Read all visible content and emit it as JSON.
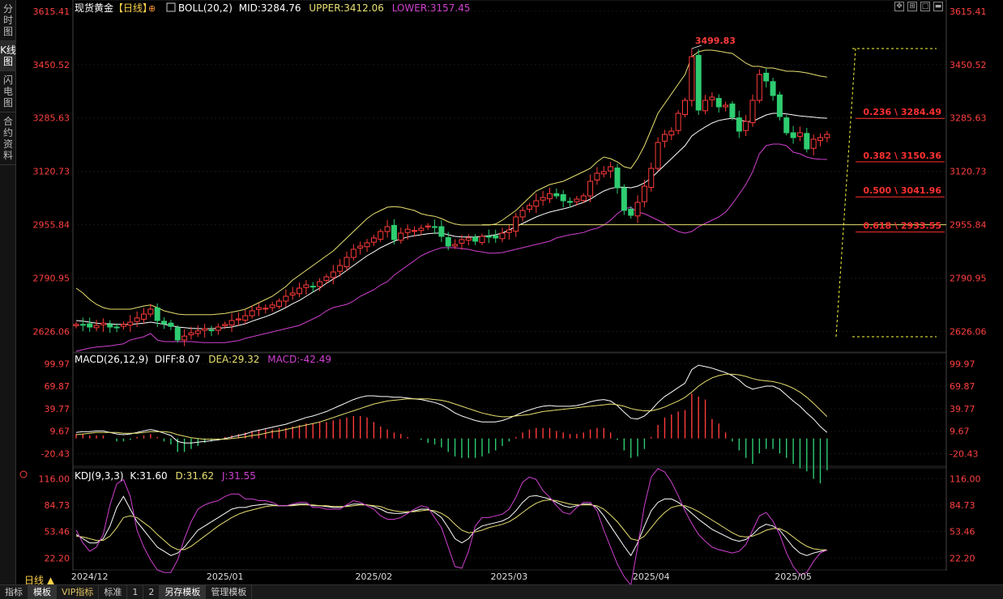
{
  "sidebar": {
    "tabs": [
      {
        "label": "分时图",
        "active": false
      },
      {
        "label": "K线图",
        "active": true
      },
      {
        "label": "闪电图",
        "active": false
      },
      {
        "label": "合约资料",
        "active": false
      }
    ]
  },
  "header": {
    "instrument": "现货黄金",
    "period_tag": "【日线】",
    "boll_label": "BOLL(20,2)",
    "mid": "MID:3284.76",
    "upper": "UPPER:3412.06",
    "lower": "LOWER:3157.45"
  },
  "macd_header": {
    "label": "MACD(26,12,9)",
    "diff": "DIFF:8.07",
    "dea": "DEA:29.32",
    "macd": "MACD:-42.49"
  },
  "kdj_header": {
    "label": "KDJ(9,3,3)",
    "k": "K:31.60",
    "d": "D:31.62",
    "j": "J:31.55"
  },
  "period_selector": "日线 ▲",
  "footer": {
    "items": [
      {
        "label": "指标",
        "active": false,
        "vip": false
      },
      {
        "label": "模板",
        "active": true,
        "vip": false
      },
      {
        "label": "VIP指标",
        "active": false,
        "vip": true
      },
      {
        "label": "标准",
        "active": false,
        "vip": false
      },
      {
        "label": "1",
        "active": false,
        "vip": false
      },
      {
        "label": "2",
        "active": false,
        "vip": false
      },
      {
        "label": "另存模板",
        "active": true,
        "vip": false
      },
      {
        "label": "管理模板",
        "active": false,
        "vip": false
      }
    ]
  },
  "colors": {
    "up": "#ff3b3b",
    "down": "#2ecc71",
    "upper": "#e8e070",
    "mid": "#ffffff",
    "lower": "#d040d0",
    "axis_text": "#ff4040",
    "grid": "#1a1a1a",
    "fib": "#ff3030"
  },
  "chart_data": [
    {
      "type": "candlestick",
      "title": "现货黄金【日线】",
      "ylim": [
        2570,
        3640
      ],
      "y_ticks": [
        3615.41,
        3450.52,
        3285.63,
        3120.73,
        2955.84,
        2790.95,
        2626.06
      ],
      "y_tick_labels": [
        "3615.41",
        "3450.52",
        "3285.63",
        "3120.73",
        "2955.84",
        "2790.95",
        "2626.06"
      ],
      "x_tick_labels": [
        {
          "label": "2024/12",
          "index": 2
        },
        {
          "label": "2025/01",
          "index": 22
        },
        {
          "label": "2025/02",
          "index": 44
        },
        {
          "label": "2025/03",
          "index": 64
        },
        {
          "label": "2025/04",
          "index": 85
        },
        {
          "label": "2025/05",
          "index": 106
        }
      ],
      "close": [
        2648,
        2646,
        2640,
        2645,
        2652,
        2640,
        2638,
        2648,
        2655,
        2668,
        2680,
        2695,
        2660,
        2650,
        2642,
        2600,
        2612,
        2622,
        2628,
        2635,
        2630,
        2640,
        2648,
        2660,
        2665,
        2675,
        2690,
        2700,
        2698,
        2708,
        2720,
        2735,
        2745,
        2760,
        2770,
        2765,
        2780,
        2795,
        2810,
        2830,
        2855,
        2880,
        2890,
        2900,
        2915,
        2935,
        2950,
        2910,
        2930,
        2942,
        2938,
        2945,
        2952,
        2948,
        2920,
        2890,
        2895,
        2910,
        2915,
        2905,
        2920,
        2918,
        2915,
        2930,
        2940,
        2980,
        3000,
        3015,
        3030,
        3040,
        3052,
        3045,
        3030,
        3025,
        3035,
        3045,
        3090,
        3115,
        3120,
        3135,
        3070,
        3000,
        2985,
        3025,
        3075,
        3130,
        3210,
        3235,
        3245,
        3300,
        3340,
        3475,
        3310,
        3340,
        3350,
        3320,
        3325,
        3288,
        3245,
        3275,
        3340,
        3420,
        3400,
        3355,
        3290,
        3240,
        3225,
        3240,
        3190,
        3220,
        3225,
        3235
      ],
      "high": [
        3499.83
      ],
      "high_index": 91,
      "high_label": "3499.83",
      "boll_upper": [
        2760,
        2745,
        2725,
        2710,
        2700,
        2695,
        2695,
        2695,
        2695,
        2700,
        2705,
        2708,
        2700,
        2690,
        2685,
        2680,
        2678,
        2678,
        2678,
        2678,
        2678,
        2680,
        2682,
        2686,
        2690,
        2695,
        2705,
        2715,
        2725,
        2735,
        2750,
        2765,
        2785,
        2800,
        2815,
        2830,
        2845,
        2860,
        2875,
        2895,
        2915,
        2935,
        2955,
        2975,
        2990,
        3000,
        3010,
        3012,
        3010,
        3005,
        3000,
        2990,
        2985,
        2982,
        2975,
        2965,
        2958,
        2955,
        2955,
        2955,
        2955,
        2955,
        2958,
        2970,
        2985,
        3000,
        3020,
        3040,
        3060,
        3070,
        3080,
        3085,
        3090,
        3100,
        3110,
        3120,
        3130,
        3150,
        3165,
        3160,
        3150,
        3135,
        3130,
        3160,
        3200,
        3250,
        3300,
        3330,
        3360,
        3390,
        3420,
        3475,
        3490,
        3495,
        3495,
        3492,
        3488,
        3485,
        3470,
        3455,
        3445,
        3445,
        3440,
        3440,
        3435,
        3430,
        3430,
        3428,
        3425,
        3420,
        3415,
        3412.06
      ],
      "boll_mid": [
        2660,
        2658,
        2655,
        2652,
        2650,
        2650,
        2648,
        2648,
        2648,
        2650,
        2652,
        2655,
        2652,
        2648,
        2645,
        2640,
        2638,
        2636,
        2635,
        2635,
        2635,
        2636,
        2638,
        2640,
        2645,
        2650,
        2658,
        2665,
        2672,
        2680,
        2690,
        2700,
        2712,
        2722,
        2735,
        2748,
        2760,
        2775,
        2788,
        2800,
        2815,
        2830,
        2845,
        2860,
        2872,
        2885,
        2895,
        2905,
        2912,
        2918,
        2922,
        2925,
        2928,
        2930,
        2930,
        2925,
        2920,
        2918,
        2918,
        2918,
        2920,
        2922,
        2925,
        2930,
        2940,
        2950,
        2960,
        2970,
        2980,
        2988,
        2995,
        3000,
        3005,
        3010,
        3018,
        3025,
        3035,
        3048,
        3060,
        3068,
        3072,
        3072,
        3070,
        3075,
        3085,
        3100,
        3120,
        3140,
        3160,
        3180,
        3200,
        3230,
        3245,
        3258,
        3270,
        3278,
        3282,
        3285,
        3280,
        3275,
        3275,
        3285,
        3295,
        3300,
        3300,
        3298,
        3295,
        3292,
        3290,
        3288,
        3286,
        3284.76
      ],
      "boll_lower": [
        2565,
        2570,
        2575,
        2578,
        2580,
        2582,
        2585,
        2588,
        2600,
        2605,
        2610,
        2620,
        2600,
        2595,
        2595,
        2595,
        2595,
        2595,
        2593,
        2592,
        2592,
        2592,
        2592,
        2595,
        2598,
        2605,
        2610,
        2615,
        2620,
        2625,
        2630,
        2635,
        2640,
        2645,
        2655,
        2665,
        2675,
        2690,
        2700,
        2705,
        2710,
        2720,
        2735,
        2745,
        2755,
        2770,
        2780,
        2800,
        2815,
        2830,
        2845,
        2860,
        2870,
        2878,
        2885,
        2885,
        2885,
        2882,
        2880,
        2875,
        2872,
        2868,
        2868,
        2870,
        2875,
        2880,
        2885,
        2890,
        2895,
        2900,
        2905,
        2915,
        2920,
        2925,
        2928,
        2932,
        2940,
        2945,
        2955,
        2970,
        2990,
        3005,
        3010,
        2995,
        2990,
        2980,
        2970,
        2960,
        2945,
        2935,
        2930,
        2935,
        2950,
        2960,
        2970,
        2980,
        2995,
        3020,
        3050,
        3080,
        3120,
        3175,
        3200,
        3205,
        3205,
        3200,
        3180,
        3175,
        3165,
        3160,
        3158,
        3157.45
      ],
      "hline": 2955.84,
      "fib_levels": [
        {
          "label": "0.236 \\ 3284.49",
          "value": 3284.49
        },
        {
          "label": "0.382 \\ 3150.36",
          "value": 3150.36
        },
        {
          "label": "0.500 \\ 3041.96",
          "value": 3041.96
        },
        {
          "label": "0.618 \\ 2933.55",
          "value": 2933.55
        }
      ],
      "fib_range": [
        2610,
        3500
      ]
    },
    {
      "type": "bar+line",
      "title": "MACD(26,12,9)",
      "ylim": [
        -35,
        110
      ],
      "y_ticks": [
        99.97,
        69.87,
        39.77,
        9.67,
        -20.43
      ],
      "y_tick_labels": [
        "99.97",
        "69.87",
        "39.77",
        "9.67",
        "-20.43"
      ],
      "diff": [
        8,
        9,
        9,
        10,
        10,
        8,
        6,
        5,
        6,
        8,
        10,
        12,
        10,
        7,
        4,
        -4,
        -6,
        -6,
        -5,
        -4,
        -3,
        -2,
        0,
        2,
        4,
        6,
        9,
        11,
        13,
        15,
        17,
        19,
        22,
        25,
        28,
        30,
        33,
        36,
        40,
        44,
        48,
        52,
        55,
        57,
        57,
        56,
        56,
        55,
        55,
        54,
        53,
        52,
        50,
        48,
        45,
        40,
        34,
        30,
        27,
        24,
        22,
        22,
        22,
        24,
        27,
        31,
        35,
        38,
        41,
        43,
        44,
        43,
        43,
        43,
        44,
        46,
        49,
        51,
        52,
        50,
        44,
        35,
        27,
        26,
        30,
        38,
        48,
        56,
        62,
        68,
        74,
        92,
        98,
        96,
        94,
        91,
        88,
        84,
        78,
        70,
        66,
        68,
        70,
        70,
        66,
        58,
        50,
        43,
        34,
        26,
        16,
        8.07
      ],
      "dea": [
        5,
        6,
        7,
        8,
        8,
        8,
        8,
        7,
        7,
        7,
        8,
        9,
        9,
        9,
        8,
        5,
        3,
        1,
        0,
        -1,
        -1,
        -1,
        -1,
        0,
        1,
        2,
        4,
        5,
        7,
        9,
        10,
        12,
        14,
        16,
        18,
        20,
        22,
        25,
        28,
        31,
        34,
        37,
        40,
        43,
        46,
        48,
        50,
        51,
        52,
        53,
        53,
        53,
        53,
        52,
        51,
        49,
        46,
        43,
        40,
        37,
        34,
        32,
        30,
        29,
        29,
        30,
        31,
        32,
        34,
        36,
        37,
        38,
        39,
        40,
        41,
        42,
        43,
        44,
        45,
        46,
        45,
        43,
        40,
        38,
        37,
        37,
        39,
        42,
        46,
        50,
        55,
        62,
        70,
        76,
        81,
        84,
        86,
        86,
        85,
        83,
        80,
        78,
        77,
        76,
        74,
        71,
        67,
        62,
        55,
        47,
        38,
        29.32
      ],
      "macd": [
        6,
        6,
        4,
        4,
        4,
        0,
        -4,
        -4,
        -2,
        2,
        4,
        6,
        2,
        -4,
        -8,
        -18,
        -18,
        -14,
        -10,
        -6,
        -4,
        -2,
        2,
        4,
        6,
        8,
        10,
        12,
        12,
        12,
        14,
        14,
        16,
        18,
        20,
        20,
        22,
        22,
        24,
        26,
        28,
        30,
        30,
        28,
        22,
        16,
        12,
        8,
        6,
        2,
        0,
        -2,
        -6,
        -8,
        -12,
        -18,
        -24,
        -26,
        -26,
        -26,
        -24,
        -20,
        -16,
        -10,
        -4,
        2,
        8,
        12,
        14,
        14,
        14,
        10,
        8,
        6,
        6,
        8,
        12,
        14,
        14,
        8,
        -2,
        -16,
        -26,
        -24,
        -14,
        2,
        18,
        28,
        32,
        36,
        38,
        60,
        56,
        52,
        26,
        20,
        8,
        -4,
        -16,
        -26,
        -34,
        -20,
        -14,
        -14,
        -20,
        -26,
        -34,
        -40,
        -44,
        -54,
        -60,
        -42.49
      ]
    },
    {
      "type": "line",
      "title": "KDJ(9,3,3)",
      "ylim": [
        10,
        125
      ],
      "y_ticks": [
        116.0,
        84.73,
        53.46,
        22.2
      ],
      "y_tick_labels": [
        "116.00",
        "84.73",
        "53.46",
        "22.20"
      ],
      "k": [
        50,
        45,
        40,
        40,
        45,
        60,
        82,
        95,
        80,
        65,
        55,
        45,
        35,
        30,
        25,
        28,
        35,
        45,
        55,
        60,
        65,
        70,
        75,
        80,
        82,
        82,
        84,
        85,
        86,
        85,
        84,
        84,
        85,
        86,
        86,
        84,
        84,
        83,
        82,
        82,
        84,
        86,
        86,
        85,
        83,
        80,
        76,
        75,
        75,
        76,
        78,
        80,
        80,
        76,
        70,
        58,
        45,
        40,
        45,
        55,
        60,
        62,
        64,
        66,
        70,
        78,
        88,
        95,
        96,
        94,
        92,
        88,
        84,
        82,
        84,
        86,
        86,
        82,
        72,
        60,
        48,
        36,
        25,
        40,
        60,
        78,
        88,
        92,
        92,
        88,
        82,
        75,
        68,
        62,
        56,
        52,
        48,
        44,
        42,
        44,
        50,
        58,
        62,
        60,
        55,
        45,
        35,
        28,
        25,
        28,
        30,
        31.6
      ],
      "d": [
        48,
        47,
        45,
        43,
        43,
        48,
        58,
        70,
        72,
        70,
        64,
        58,
        50,
        43,
        36,
        32,
        32,
        36,
        42,
        48,
        54,
        60,
        65,
        70,
        74,
        77,
        79,
        81,
        83,
        84,
        84,
        84,
        84,
        85,
        85,
        85,
        84,
        84,
        83,
        83,
        83,
        84,
        85,
        85,
        84,
        83,
        80,
        78,
        77,
        77,
        77,
        78,
        79,
        78,
        75,
        70,
        62,
        55,
        52,
        53,
        55,
        58,
        60,
        62,
        65,
        70,
        76,
        82,
        87,
        90,
        91,
        90,
        88,
        86,
        85,
        85,
        85,
        84,
        80,
        73,
        65,
        55,
        45,
        43,
        48,
        58,
        68,
        76,
        82,
        84,
        84,
        81,
        77,
        72,
        67,
        62,
        57,
        52,
        48,
        47,
        48,
        51,
        55,
        57,
        57,
        53,
        47,
        41,
        36,
        33,
        32,
        31.62
      ],
      "j": [
        55,
        40,
        30,
        35,
        50,
        85,
        110,
        115,
        95,
        55,
        35,
        20,
        8,
        5,
        5,
        20,
        45,
        65,
        80,
        85,
        88,
        90,
        95,
        98,
        98,
        92,
        92,
        90,
        90,
        88,
        84,
        84,
        86,
        88,
        88,
        82,
        82,
        80,
        80,
        80,
        85,
        90,
        88,
        84,
        80,
        72,
        68,
        68,
        70,
        75,
        80,
        84,
        82,
        70,
        58,
        35,
        12,
        10,
        30,
        60,
        70,
        70,
        72,
        74,
        80,
        94,
        112,
        118,
        115,
        102,
        94,
        84,
        76,
        74,
        82,
        88,
        88,
        78,
        55,
        35,
        15,
        0,
        -10,
        35,
        84,
        118,
        128,
        124,
        112,
        96,
        78,
        63,
        50,
        42,
        35,
        32,
        30,
        28,
        30,
        38,
        55,
        72,
        76,
        66,
        50,
        28,
        12,
        2,
        5,
        18,
        28,
        31.55
      ]
    }
  ]
}
